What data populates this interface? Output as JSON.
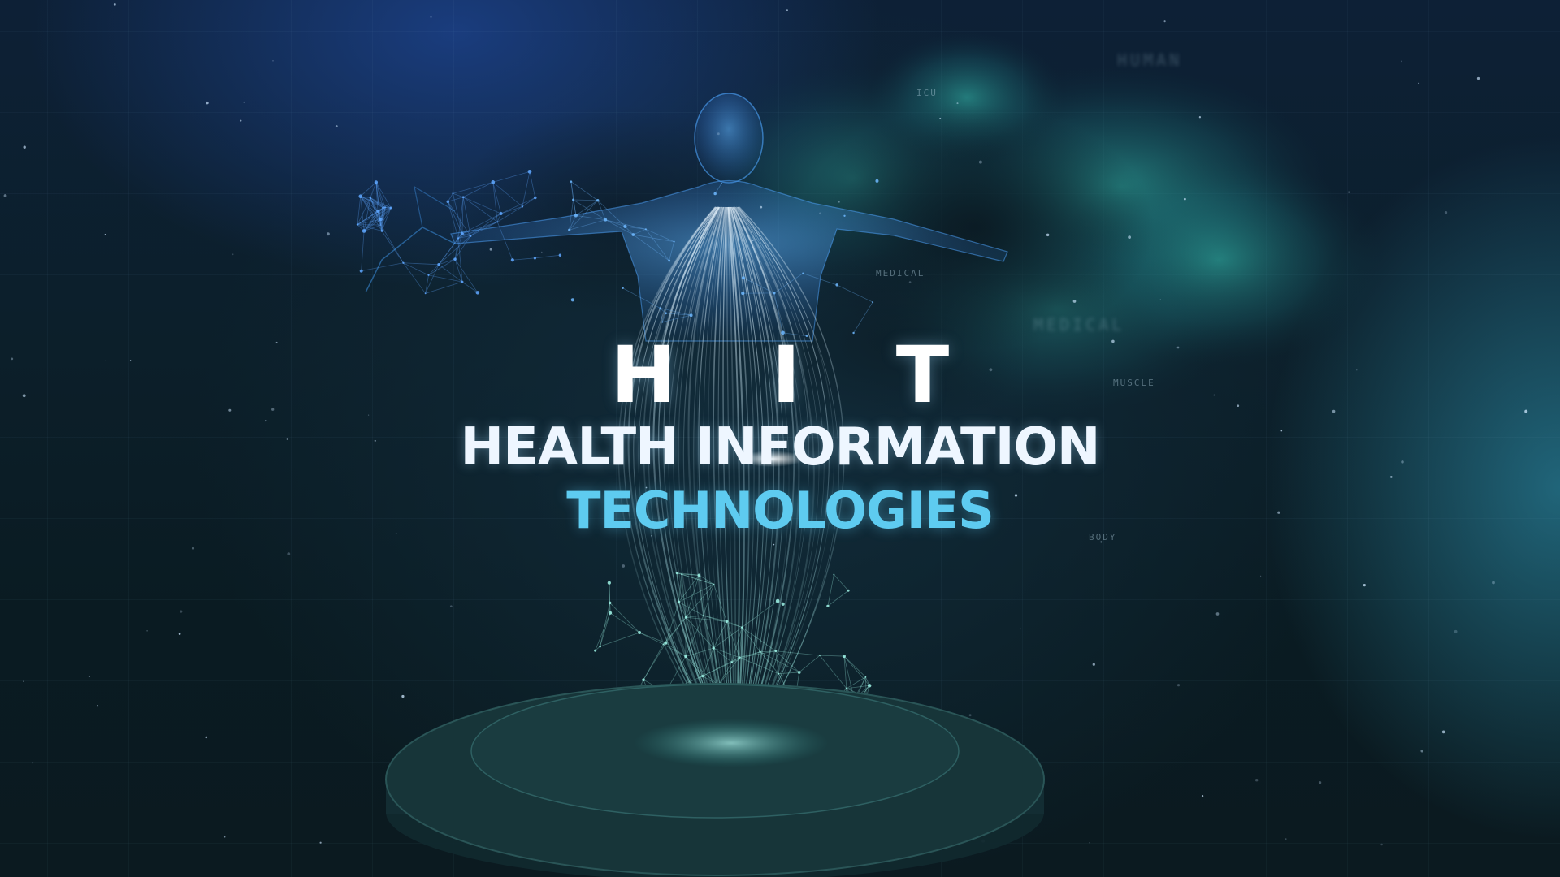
{
  "title": {
    "acronym": "H I T",
    "line1": "HEALTH INFORMATION",
    "line2": "TECHNOLOGIES"
  },
  "micro_labels": {
    "human": "HUMAN",
    "icu": "ICU",
    "medical": "MEDICAL",
    "muscle": "MUSCLE",
    "body": "BODY"
  },
  "colors": {
    "accent": "#5ecbf0",
    "title_white": "#ffffff",
    "smoke_teal": "#2fb3a6",
    "hologram_blue": "#3c8fe0",
    "background": "#0b1a22"
  }
}
